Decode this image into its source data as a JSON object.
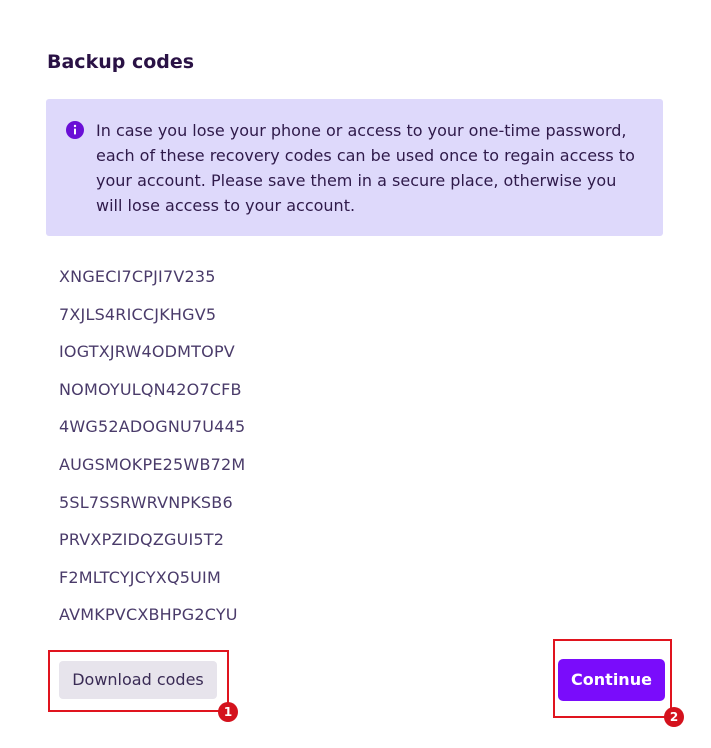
{
  "dialog": {
    "title": "Backup codes",
    "info_icon": "info-circle-icon",
    "info_message": "In case you lose your phone or access to your one-time password, each of these recovery codes can be used once to regain access to your account. Please save them in a secure place, otherwise you will lose access to your account."
  },
  "codes": [
    "XNGECI7CPJI7V235",
    "7XJLS4RICCJKHGV5",
    "IOGTXJRW4ODMTOPV",
    "NOMOYULQN42O7CFB",
    "4WG52ADOGNU7U445",
    "AUGSMOKPE25WB72M",
    "5SL7SSRWRVNPKSB6",
    "PRVXPZIDQZGUI5T2",
    "F2MLTCYJCYXQ5UIM",
    "AVMKPVCXBHPG2CYU"
  ],
  "actions": {
    "download_label": "Download codes",
    "continue_label": "Continue"
  },
  "annotations": {
    "marker_1": "1",
    "marker_2": "2"
  },
  "colors": {
    "accent": "#7a0cfb",
    "info_background": "#ded9fb",
    "highlight": "#e0141e"
  }
}
